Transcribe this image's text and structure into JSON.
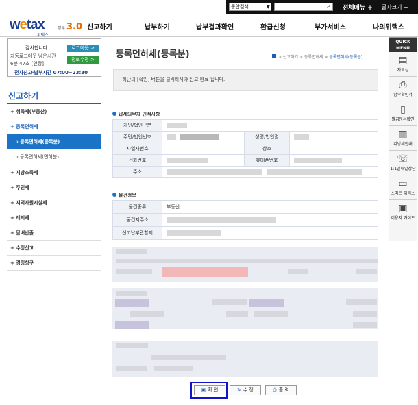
{
  "topbar": {
    "search_select": "통합검색",
    "menu_all": "전체메뉴 +",
    "font_size": "글자크기 +"
  },
  "header": {
    "logo": {
      "brand_a": "w",
      "brand_e": "e",
      "brand_b": "tax",
      "sub": "위택스",
      "ver_label": "정부",
      "ver": "3.0"
    },
    "nav": [
      "신고하기",
      "납부하기",
      "납부결과확인",
      "환급신청",
      "부가서비스",
      "나의위택스"
    ]
  },
  "login": {
    "greeting": "감사합니다.",
    "remaining_label": "자동로그아웃 남은시간",
    "remaining_time": "6분 47초 [연장]",
    "hours": "전자신고·납부시간 07:00~23:30",
    "logout_btn": "로그아웃 >",
    "info_btn": "정보수정 >"
  },
  "lnb": {
    "title": "신고하기",
    "items": [
      {
        "label": "+ 취득세(부동산)"
      },
      {
        "label": "+ 등록면허세"
      },
      {
        "label": "+ 지방소득세"
      },
      {
        "label": "+ 주민세"
      },
      {
        "label": "+ 지역자원시설세"
      },
      {
        "label": "+ 레저세"
      },
      {
        "label": "+ 담배반출"
      },
      {
        "label": "+ 수정신고"
      },
      {
        "label": "+ 경정청구"
      }
    ],
    "subitems": [
      "› 등록면허세(등록분)",
      "› 등록면허세(면허분)"
    ]
  },
  "quick": {
    "head": "QUICK MENU",
    "items": [
      {
        "label": "자료실",
        "icon": "disk-icon"
      },
      {
        "label": "납부확인서",
        "icon": "printer-icon"
      },
      {
        "label": "발급문서확인",
        "icon": "document-icon"
      },
      {
        "label": "지방세안내",
        "icon": "book-icon"
      },
      {
        "label": "1:1일대일상담",
        "icon": "chat-icon"
      },
      {
        "label": "스마트 위택스",
        "icon": "phone-icon"
      },
      {
        "label": "이용자 가이드",
        "icon": "guide-icon"
      }
    ]
  },
  "main": {
    "title": "등록면허세(등록분)",
    "breadcrumb": "> 신고하기 > 등록면허세 > ",
    "breadcrumb_current": "등록면허세(등록분)",
    "notice": "· 하단의 [확인] 버튼을 클릭하셔야 신고 완료 됩니다.",
    "section1": "납세의무자 인적사항",
    "section1_rows": {
      "type": "개인/법인구분",
      "id": "주민/법인번호",
      "name": "성명/법인명",
      "biz_no": "사업자번호",
      "trade": "상호",
      "phone": "전화번호",
      "mobile": "휴대폰번호",
      "addr": "주소"
    },
    "section2": "물건정보",
    "section2_rows": {
      "kind": "물건종류",
      "kind_value": "부동산",
      "location": "물건지주소",
      "office": "신고납부관할지"
    }
  },
  "buttons": {
    "confirm": "확 인",
    "edit": "수 정",
    "print": "출 력"
  }
}
